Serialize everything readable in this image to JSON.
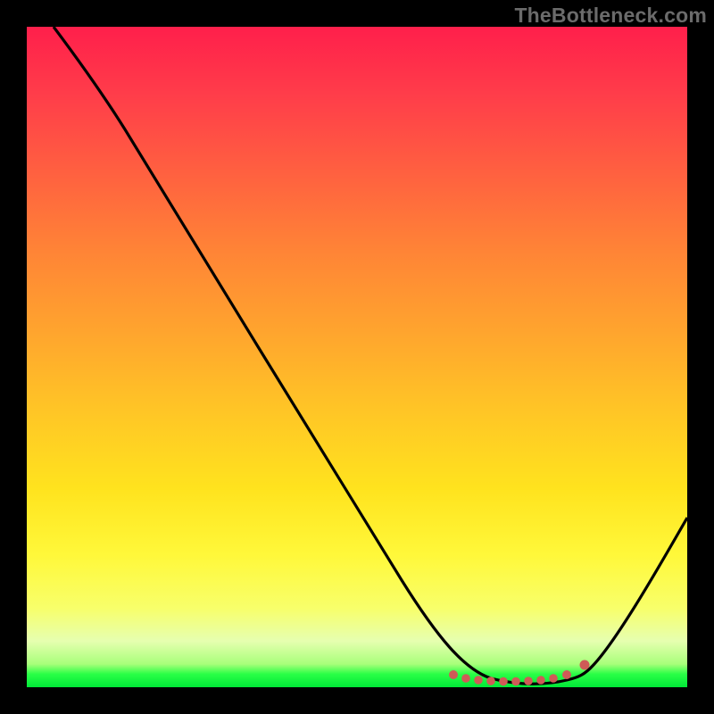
{
  "watermark": "TheBottleneck.com",
  "chart_data": {
    "type": "line",
    "title": "",
    "xlabel": "",
    "ylabel": "",
    "xlim": [
      0,
      100
    ],
    "ylim": [
      0,
      100
    ],
    "series": [
      {
        "name": "bottleneck-curve",
        "x": [
          0,
          5,
          10,
          15,
          20,
          25,
          30,
          35,
          40,
          45,
          50,
          55,
          60,
          62,
          65,
          70,
          75,
          80,
          82,
          85,
          90,
          95,
          100
        ],
        "y": [
          100,
          96,
          91,
          85,
          78,
          70,
          62,
          54,
          46,
          38,
          30,
          22,
          14,
          10,
          6,
          3,
          2,
          2,
          3,
          5,
          10,
          18,
          28
        ]
      },
      {
        "name": "trough-markers",
        "x": [
          64,
          66,
          68,
          70,
          72,
          74,
          76,
          78,
          80,
          82
        ],
        "y": [
          3.2,
          2.5,
          2.1,
          2.0,
          1.9,
          1.9,
          2.0,
          2.2,
          2.6,
          3.4
        ]
      }
    ],
    "annotations": [],
    "colors": {
      "curve": "#000000",
      "markers": "#cf5b57",
      "gradient_top": "#ff1f4b",
      "gradient_mid": "#ffe31e",
      "gradient_bottom": "#00e838"
    },
    "grid": false,
    "legend": false
  }
}
